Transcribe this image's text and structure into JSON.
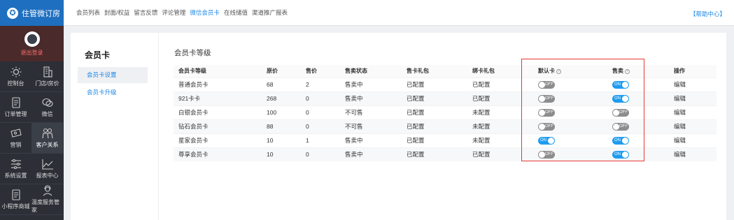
{
  "brand": {
    "name": "住管微订房"
  },
  "user": {
    "logout": "退出登录"
  },
  "sidebar": {
    "items": [
      {
        "label": "控制台",
        "icon": "sun-icon"
      },
      {
        "label": "门店/房价",
        "icon": "building-icon"
      },
      {
        "label": "订单管理",
        "icon": "document-icon"
      },
      {
        "label": "微信",
        "icon": "chat-icon"
      },
      {
        "label": "营销",
        "icon": "ticket-icon"
      },
      {
        "label": "客户关系",
        "icon": "people-icon"
      },
      {
        "label": "系统设置",
        "icon": "sliders-icon"
      },
      {
        "label": "报表中心",
        "icon": "line-chart-icon"
      },
      {
        "label": "小程序商城",
        "icon": "document-icon"
      },
      {
        "label": "温度服务管家",
        "icon": "service-icon"
      }
    ]
  },
  "top_tabs": [
    "会员列表",
    "封面/权益",
    "留言反馈",
    "评论管理",
    "微信会员卡",
    "在线储值",
    "渠道推广报表"
  ],
  "help_link": "【帮助中心】",
  "subnav": {
    "title": "会员卡",
    "items": [
      "会员卡设置",
      "会员卡升级"
    ]
  },
  "section_title": "会员卡等级",
  "table": {
    "headers": [
      "会员卡等级",
      "原价",
      "售价",
      "售卖状态",
      "售卡礼包",
      "绑卡礼包",
      "默认卡",
      "售卖",
      "操作"
    ],
    "rows": [
      {
        "name": "普通会员卡",
        "orig": "68",
        "price": "2",
        "status": "售卖中",
        "sell_gift": "已配置",
        "bind_gift": "已配置",
        "bind_link": true,
        "default_on": false,
        "sale_on": true,
        "op": "编辑"
      },
      {
        "name": "921卡卡",
        "orig": "268",
        "price": "0",
        "status": "售卖中",
        "sell_gift": "已配置",
        "bind_gift": "已配置",
        "bind_link": true,
        "default_on": false,
        "sale_on": true,
        "op": "编辑"
      },
      {
        "name": "白银会员卡",
        "orig": "100",
        "price": "0",
        "status": "不可售",
        "sell_gift": "已配置",
        "bind_gift": "未配置",
        "bind_link": false,
        "default_on": false,
        "sale_on": false,
        "op": "编辑"
      },
      {
        "name": "钻石会员卡",
        "orig": "88",
        "price": "0",
        "status": "不可售",
        "sell_gift": "已配置",
        "bind_gift": "未配置",
        "bind_link": false,
        "default_on": false,
        "sale_on": false,
        "op": "编辑"
      },
      {
        "name": "星家会员卡",
        "orig": "10",
        "price": "1",
        "status": "售卖中",
        "sell_gift": "已配置",
        "bind_gift": "未配置",
        "bind_link": false,
        "default_on": true,
        "sale_on": true,
        "op": "编辑"
      },
      {
        "name": "尊享会员卡",
        "orig": "10",
        "price": "0",
        "status": "售卖中",
        "sell_gift": "已配置",
        "bind_gift": "已配置",
        "bind_link": true,
        "default_on": false,
        "sale_on": true,
        "op": "编辑"
      }
    ]
  },
  "toggle": {
    "on": "ON",
    "off": "OFF"
  },
  "colors": {
    "accent": "#1e88e5",
    "highlight": "#e53935",
    "brand_bar": "#1e6fbf",
    "sidebar": "#2c2f36"
  }
}
